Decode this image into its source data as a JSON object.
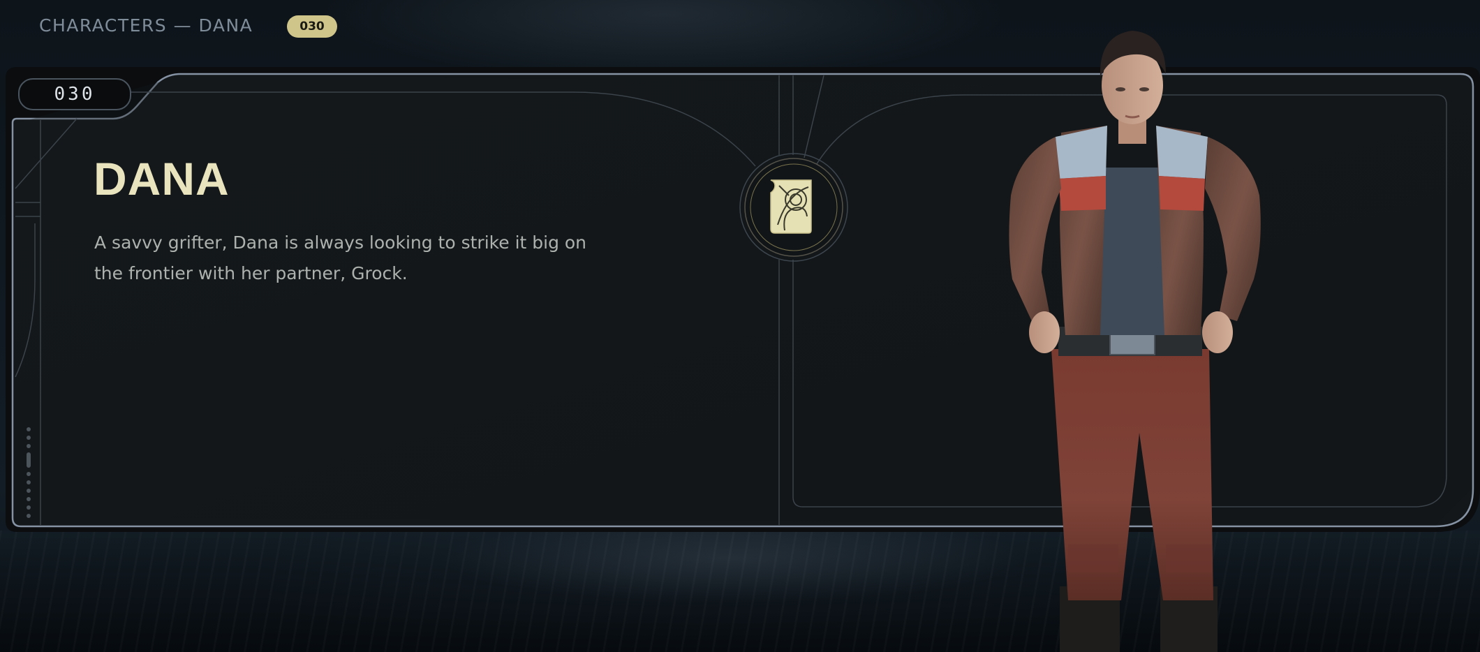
{
  "header": {
    "breadcrumb": "CHARACTERS — DANA",
    "badge": "030"
  },
  "panel": {
    "number": "030",
    "name": "DANA",
    "description": "A savvy grifter, Dana is always looking to strike it big on the frontier with her partner, Grock.",
    "emblem_icon": "databank-emblem-icon"
  },
  "colors": {
    "accent_gold": "#cfc48a",
    "title_cream": "#e9e4be",
    "panel_border": "#8592a3",
    "panel_bg": "#121619"
  }
}
